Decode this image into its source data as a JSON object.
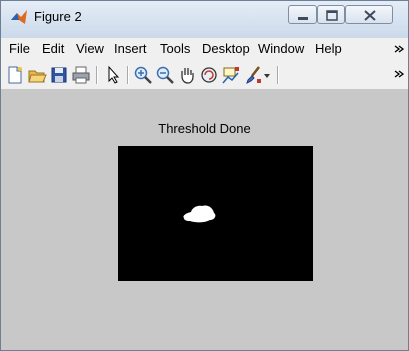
{
  "window": {
    "title": "Figure 2"
  },
  "menu": [
    "File",
    "Edit",
    "View",
    "Insert",
    "Tools",
    "Desktop",
    "Window",
    "Help"
  ],
  "toolbar": {
    "icons": [
      "new-figure-icon",
      "open-file-icon",
      "save-icon",
      "print-icon",
      "arrow-select-icon",
      "zoom-in-icon",
      "zoom-out-icon",
      "pan-icon",
      "rotate-3d-icon",
      "data-cursor-icon",
      "brush-icon",
      "chevron-down-icon",
      "overflow-chevron-icon"
    ]
  },
  "figure": {
    "axes_title": "Threshold Done"
  },
  "colors": {
    "figure_background": "#c8c8c8",
    "image_background": "#000000",
    "blob": "#ffffff"
  }
}
